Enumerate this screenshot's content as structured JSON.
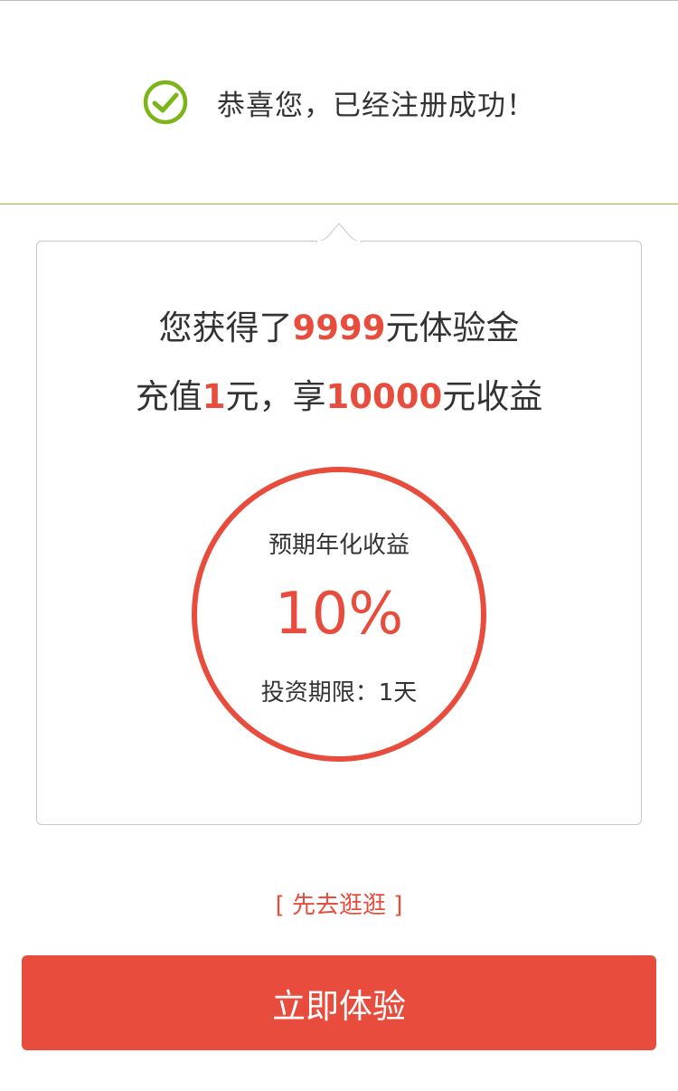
{
  "success": {
    "message": "恭喜您，已经注册成功！",
    "icon": "check-circle-icon",
    "icon_color": "#7cb518"
  },
  "offer": {
    "line1_prefix": "您获得了",
    "line1_amount": "9999",
    "line1_suffix": "元体验金",
    "line2_prefix": "充值",
    "line2_amount": "1",
    "line2_middle": "元，享",
    "line2_return": "10000",
    "line2_suffix": "元收益"
  },
  "yield_circle": {
    "label": "预期年化收益",
    "rate": "10%",
    "term": "投资期限：1天"
  },
  "browse_link": "[ 先去逛逛 ]",
  "cta_button": "立即体验",
  "colors": {
    "accent": "#e84c3d",
    "divider": "#9ab83a",
    "text": "#333333"
  }
}
